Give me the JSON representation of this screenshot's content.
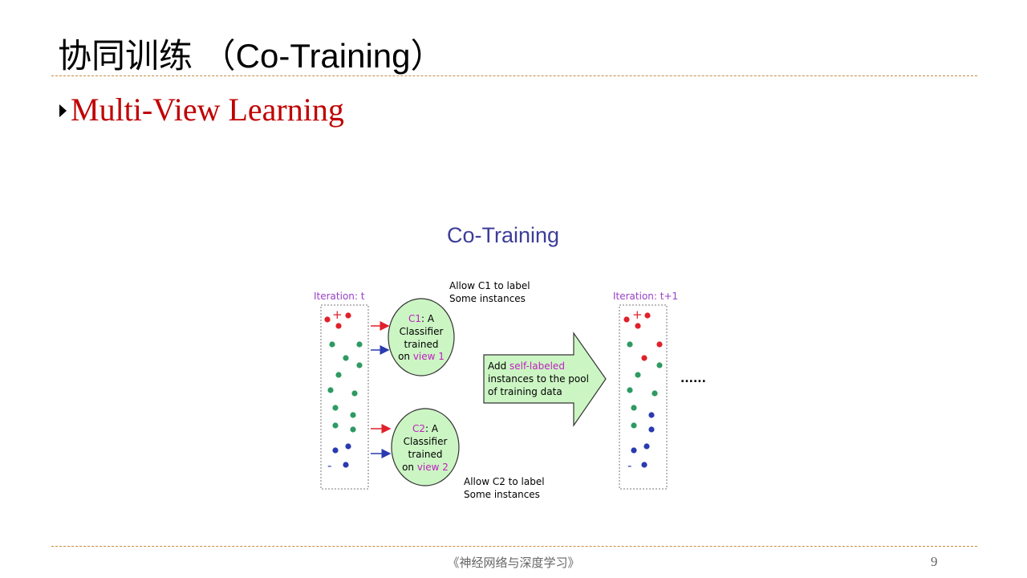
{
  "slide": {
    "title": "协同训练 （Co-Training）",
    "bullet": "Multi-View Learning",
    "footer": "《神经网络与深度学习》",
    "page_number": "9"
  },
  "diagram": {
    "title": "Co-Training",
    "left_pool_label": "Iteration: t",
    "right_pool_label": "Iteration: t+1",
    "plus": "+",
    "minus": "-",
    "c1": {
      "name": "C1",
      "text1": ": A",
      "text2": "Classifier",
      "text3": "trained",
      "text4": "on ",
      "view": "view 1"
    },
    "c2": {
      "name": "C2",
      "text1": ": A",
      "text2": "Classifier",
      "text3": "trained",
      "text4": "on ",
      "view": "view 2"
    },
    "allow_c1": [
      "Allow C1 to label",
      "Some instances"
    ],
    "allow_c2": [
      "Allow C2 to label",
      "Some instances"
    ],
    "arrow": {
      "line1_pre": "Add ",
      "line1_hl": "self-labeled",
      "line2": "instances to the pool",
      "line3": "of training data"
    },
    "ellipsis": "......",
    "colors": {
      "positive": "#e0202a",
      "unlabeled": "#2e9a62",
      "negative": "#2a3ab0",
      "classifier_fill": "#ccf5c4",
      "arrow_fill": "#ccf5c4",
      "highlight": "#c020c0",
      "label": "#9a40c8"
    }
  }
}
